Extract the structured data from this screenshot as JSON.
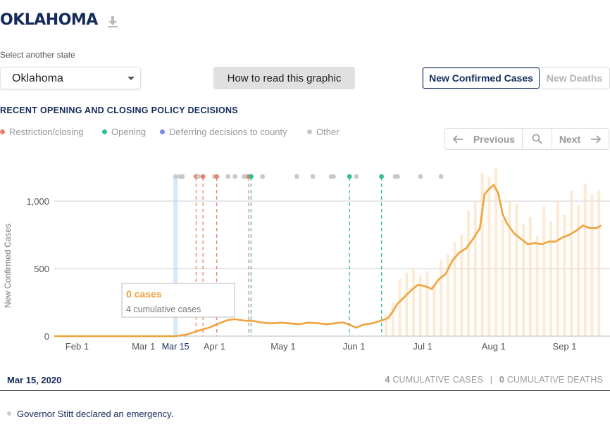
{
  "page": {
    "state_title": "OKLAHOMA"
  },
  "selector": {
    "label": "Select another state",
    "value": "Oklahoma"
  },
  "buttons": {
    "how_to_read": "How to read this graphic"
  },
  "metric_toggle": {
    "cases": "New Confirmed Cases",
    "deaths": "New Deaths",
    "active": "cases"
  },
  "policy": {
    "heading": "RECENT OPENING AND CLOSING POLICY DECISIONS",
    "legend": [
      {
        "key": "restriction",
        "label": "Restriction/closing",
        "color": "#e8836a"
      },
      {
        "key": "opening",
        "label": "Opening",
        "color": "#2fbf97"
      },
      {
        "key": "county",
        "label": "Deferring decisions to county",
        "color": "#7e8ce8"
      },
      {
        "key": "other",
        "label": "Other",
        "color": "#c8c8c8"
      }
    ]
  },
  "pager": {
    "previous": "Previous",
    "next": "Next"
  },
  "chart_data": {
    "type": "line",
    "ylabel": "New Confirmed Cases",
    "ylim": [
      0,
      1250
    ],
    "xlim": [
      "2020-01-22",
      "2020-09-19"
    ],
    "yticks": [
      {
        "value": 0,
        "label": "0"
      },
      {
        "value": 500,
        "label": "500"
      },
      {
        "value": 1000,
        "label": "1,000"
      }
    ],
    "xticks": [
      {
        "date": "2020-02-01",
        "label": "Feb 1"
      },
      {
        "date": "2020-03-01",
        "label": "Mar 1"
      },
      {
        "date": "2020-04-01",
        "label": "Apr 1"
      },
      {
        "date": "2020-05-01",
        "label": "May 1"
      },
      {
        "date": "2020-06-01",
        "label": "Jun 1"
      },
      {
        "date": "2020-07-01",
        "label": "Jul 1"
      },
      {
        "date": "2020-08-01",
        "label": "Aug 1"
      },
      {
        "date": "2020-09-01",
        "label": "Sep 1"
      }
    ],
    "selected": {
      "date": "2020-03-15",
      "label": "Mar 15",
      "cases_label": "0 cases",
      "cumulative_label": "4 cumulative cases"
    },
    "series": [
      {
        "kind": "seven_day_average",
        "color": "#f0a23c",
        "points": [
          [
            "2020-01-22",
            0
          ],
          [
            "2020-03-10",
            0
          ],
          [
            "2020-03-15",
            0
          ],
          [
            "2020-03-20",
            12
          ],
          [
            "2020-03-25",
            40
          ],
          [
            "2020-03-30",
            65
          ],
          [
            "2020-04-03",
            95
          ],
          [
            "2020-04-07",
            120
          ],
          [
            "2020-04-10",
            125
          ],
          [
            "2020-04-14",
            115
          ],
          [
            "2020-04-18",
            112
          ],
          [
            "2020-04-22",
            100
          ],
          [
            "2020-04-26",
            95
          ],
          [
            "2020-04-30",
            100
          ],
          [
            "2020-05-04",
            95
          ],
          [
            "2020-05-08",
            88
          ],
          [
            "2020-05-12",
            100
          ],
          [
            "2020-05-16",
            96
          ],
          [
            "2020-05-20",
            88
          ],
          [
            "2020-05-24",
            96
          ],
          [
            "2020-05-27",
            102
          ],
          [
            "2020-05-30",
            85
          ],
          [
            "2020-06-02",
            62
          ],
          [
            "2020-06-05",
            85
          ],
          [
            "2020-06-09",
            95
          ],
          [
            "2020-06-13",
            115
          ],
          [
            "2020-06-16",
            135
          ],
          [
            "2020-06-18",
            185
          ],
          [
            "2020-06-20",
            240
          ],
          [
            "2020-06-23",
            290
          ],
          [
            "2020-06-26",
            340
          ],
          [
            "2020-06-29",
            380
          ],
          [
            "2020-07-02",
            370
          ],
          [
            "2020-07-05",
            350
          ],
          [
            "2020-07-08",
            420
          ],
          [
            "2020-07-11",
            460
          ],
          [
            "2020-07-14",
            560
          ],
          [
            "2020-07-17",
            620
          ],
          [
            "2020-07-20",
            650
          ],
          [
            "2020-07-23",
            720
          ],
          [
            "2020-07-26",
            800
          ],
          [
            "2020-07-28",
            1050
          ],
          [
            "2020-07-30",
            1090
          ],
          [
            "2020-08-01",
            1120
          ],
          [
            "2020-08-03",
            1060
          ],
          [
            "2020-08-05",
            900
          ],
          [
            "2020-08-07",
            830
          ],
          [
            "2020-08-10",
            760
          ],
          [
            "2020-08-13",
            720
          ],
          [
            "2020-08-16",
            680
          ],
          [
            "2020-08-19",
            690
          ],
          [
            "2020-08-22",
            680
          ],
          [
            "2020-08-25",
            700
          ],
          [
            "2020-08-28",
            700
          ],
          [
            "2020-08-31",
            730
          ],
          [
            "2020-09-03",
            750
          ],
          [
            "2020-09-06",
            780
          ],
          [
            "2020-09-09",
            820
          ],
          [
            "2020-09-12",
            800
          ],
          [
            "2020-09-15",
            800
          ],
          [
            "2020-09-17",
            820
          ]
        ]
      },
      {
        "kind": "daily_bars",
        "color": "#fbe3c6",
        "points": [
          [
            "2020-06-15",
            160
          ],
          [
            "2020-06-18",
            250
          ],
          [
            "2020-06-21",
            420
          ],
          [
            "2020-06-24",
            470
          ],
          [
            "2020-06-27",
            500
          ],
          [
            "2020-06-30",
            450
          ],
          [
            "2020-07-03",
            480
          ],
          [
            "2020-07-06",
            380
          ],
          [
            "2020-07-09",
            560
          ],
          [
            "2020-07-12",
            610
          ],
          [
            "2020-07-15",
            700
          ],
          [
            "2020-07-18",
            750
          ],
          [
            "2020-07-21",
            930
          ],
          [
            "2020-07-24",
            1000
          ],
          [
            "2020-07-27",
            1210
          ],
          [
            "2020-07-30",
            1180
          ],
          [
            "2020-08-02",
            1250
          ],
          [
            "2020-08-05",
            870
          ],
          [
            "2020-08-08",
            1000
          ],
          [
            "2020-08-11",
            980
          ],
          [
            "2020-08-14",
            830
          ],
          [
            "2020-08-17",
            880
          ],
          [
            "2020-08-20",
            740
          ],
          [
            "2020-08-23",
            960
          ],
          [
            "2020-08-26",
            850
          ],
          [
            "2020-08-29",
            1000
          ],
          [
            "2020-09-01",
            900
          ],
          [
            "2020-09-04",
            1080
          ],
          [
            "2020-09-07",
            970
          ],
          [
            "2020-09-10",
            1130
          ],
          [
            "2020-09-13",
            1050
          ],
          [
            "2020-09-16",
            1080
          ]
        ]
      }
    ],
    "policy_events": [
      {
        "date": "2020-03-15",
        "type": "other"
      },
      {
        "date": "2020-03-17",
        "type": "other"
      },
      {
        "date": "2020-03-18",
        "type": "other"
      },
      {
        "date": "2020-03-24",
        "type": "restriction",
        "line": true
      },
      {
        "date": "2020-03-25",
        "type": "other"
      },
      {
        "date": "2020-03-27",
        "type": "restriction",
        "line": true
      },
      {
        "date": "2020-04-01",
        "type": "other"
      },
      {
        "date": "2020-04-02",
        "type": "restriction",
        "line": true
      },
      {
        "date": "2020-04-07",
        "type": "other"
      },
      {
        "date": "2020-04-10",
        "type": "other"
      },
      {
        "date": "2020-04-14",
        "type": "other"
      },
      {
        "date": "2020-04-15",
        "type": "other"
      },
      {
        "date": "2020-04-16",
        "type": "restriction",
        "line": true
      },
      {
        "date": "2020-04-17",
        "type": "opening",
        "line": true
      },
      {
        "date": "2020-04-22",
        "type": "other"
      },
      {
        "date": "2020-05-07",
        "type": "other"
      },
      {
        "date": "2020-05-14",
        "type": "other"
      },
      {
        "date": "2020-05-22",
        "type": "other"
      },
      {
        "date": "2020-05-23",
        "type": "other"
      },
      {
        "date": "2020-05-30",
        "type": "opening",
        "line": true
      },
      {
        "date": "2020-06-02",
        "type": "other"
      },
      {
        "date": "2020-06-13",
        "type": "opening",
        "line": true
      },
      {
        "date": "2020-06-19",
        "type": "other"
      },
      {
        "date": "2020-06-20",
        "type": "other"
      },
      {
        "date": "2020-06-30",
        "type": "other"
      },
      {
        "date": "2020-07-09",
        "type": "other"
      }
    ]
  },
  "footer": {
    "date": "Mar 15, 2020",
    "cumulative_cases_value": "4",
    "cumulative_cases_label": "CUMULATIVE CASES",
    "separator": "|",
    "cumulative_deaths_value": "0",
    "cumulative_deaths_label": "CUMULATIVE DEATHS"
  },
  "events": [
    {
      "text": "Governor Stitt declared an emergency.",
      "type": "other"
    }
  ]
}
